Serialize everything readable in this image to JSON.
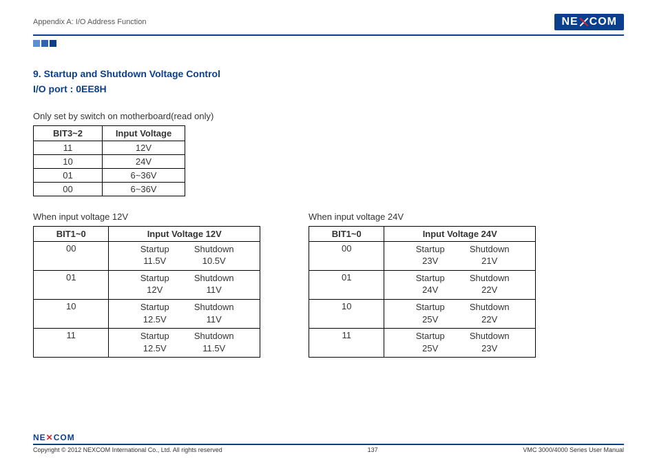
{
  "header": {
    "appendix": "Appendix A: I/O Address Function",
    "brand": "NE COM"
  },
  "section": {
    "title_line1": "9.  Startup and Shutdown Voltage Control",
    "title_line2": "I/O port : 0EE8H",
    "note": "Only set by switch on motherboard(read only)"
  },
  "table1": {
    "head": [
      "BIT3~2",
      "Input Voltage"
    ],
    "rows": [
      [
        "11",
        "12V"
      ],
      [
        "10",
        "24V"
      ],
      [
        "01",
        "6~36V"
      ],
      [
        "00",
        "6~36V"
      ]
    ]
  },
  "col12": {
    "caption": "When input voltage 12V",
    "head": [
      "BIT1~0",
      "Input Voltage 12V"
    ],
    "labels": {
      "startup": "Startup",
      "shutdown": "Shutdown"
    },
    "rows": [
      {
        "bit": "00",
        "startup": "11.5V",
        "shutdown": "10.5V"
      },
      {
        "bit": "01",
        "startup": "12V",
        "shutdown": "11V"
      },
      {
        "bit": "10",
        "startup": "12.5V",
        "shutdown": "11V"
      },
      {
        "bit": "11",
        "startup": "12.5V",
        "shutdown": "11.5V"
      }
    ]
  },
  "col24": {
    "caption": "When input voltage 24V",
    "head": [
      "BIT1~0",
      "Input Voltage 24V"
    ],
    "labels": {
      "startup": "Startup",
      "shutdown": "Shutdown"
    },
    "rows": [
      {
        "bit": "00",
        "startup": "23V",
        "shutdown": "21V"
      },
      {
        "bit": "01",
        "startup": "24V",
        "shutdown": "22V"
      },
      {
        "bit": "10",
        "startup": "25V",
        "shutdown": "22V"
      },
      {
        "bit": "11",
        "startup": "25V",
        "shutdown": "23V"
      }
    ]
  },
  "footer": {
    "brand": "NE COM",
    "copyright": "Copyright © 2012 NEXCOM International Co., Ltd. All rights reserved",
    "page": "137",
    "manual": "VMC 3000/4000 Series User Manual"
  }
}
